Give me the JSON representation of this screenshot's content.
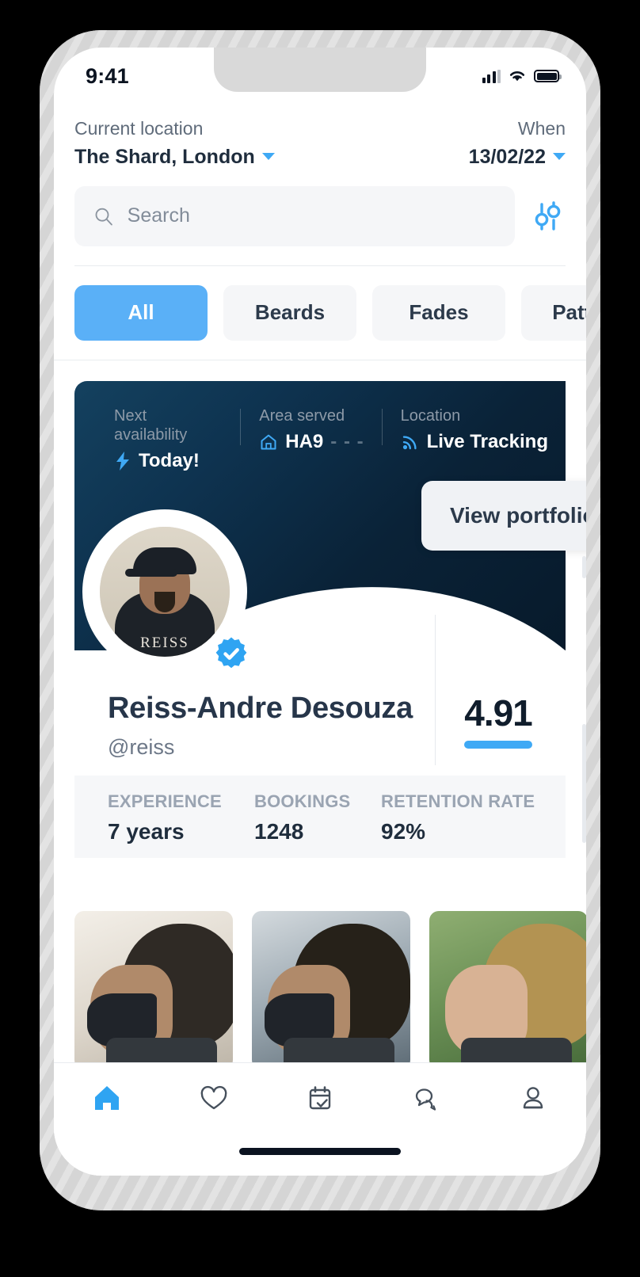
{
  "status_bar": {
    "time": "9:41",
    "signal_icon": "cellular-signal-icon",
    "wifi_icon": "wifi-icon",
    "battery_icon": "battery-icon"
  },
  "header": {
    "location_label": "Current location",
    "location_value": "The Shard, London",
    "when_label": "When",
    "when_value": "13/02/22"
  },
  "search": {
    "placeholder": "Search",
    "value": "",
    "search_icon": "search-icon",
    "filter_icon": "filter-sliders-icon"
  },
  "categories": [
    {
      "label": "All",
      "active": true
    },
    {
      "label": "Beards",
      "active": false
    },
    {
      "label": "Fades",
      "active": false
    },
    {
      "label": "Pattern",
      "active": false
    }
  ],
  "barber_card": {
    "info": [
      {
        "label": "Next availability",
        "value": "Today!",
        "icon": "lightning-bolt-icon",
        "suffix": ""
      },
      {
        "label": "Area served",
        "value": "HA9",
        "icon": "home-icon",
        "suffix": "- - -"
      },
      {
        "label": "Location",
        "value": "Live Tracking",
        "icon": "live-broadcast-icon",
        "suffix": ""
      }
    ],
    "portfolio_button": "View portfolio",
    "avatar_caption": "REISS",
    "verified_icon": "verified-badge-icon",
    "name": "Reiss-Andre Desouza",
    "handle": "@reiss",
    "rating": "4.91",
    "stats": [
      {
        "label": "EXPERIENCE",
        "value": "7 years"
      },
      {
        "label": "BOOKINGS",
        "value": "1248"
      },
      {
        "label": "RETENTION RATE",
        "value": "92%"
      }
    ]
  },
  "portfolio_thumbnails": [
    {
      "name": "haircut-photo-1"
    },
    {
      "name": "haircut-photo-2"
    },
    {
      "name": "haircut-photo-3"
    }
  ],
  "bottom_nav": [
    {
      "icon": "home-icon",
      "active": true
    },
    {
      "icon": "heart-icon",
      "active": false
    },
    {
      "icon": "calendar-check-icon",
      "active": false
    },
    {
      "icon": "chat-bubbles-icon",
      "active": false
    },
    {
      "icon": "person-icon",
      "active": false
    }
  ],
  "colors": {
    "accent_blue": "#3fa9f5",
    "chip_active": "#5ab0f7",
    "card_navy_light": "#14415f",
    "card_navy_dark": "#071a2b",
    "text_dark": "#1f2d3d",
    "text_muted": "#6c7787"
  }
}
